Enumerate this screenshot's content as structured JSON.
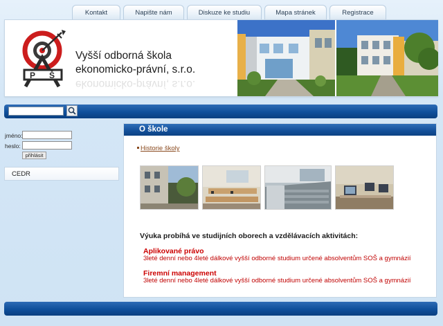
{
  "nav": {
    "tabs": [
      "Kontakt",
      "Napište nám",
      "Diskuze ke studiu",
      "Mapa stránek",
      "Registrace"
    ]
  },
  "header": {
    "logo_letters": [
      "P",
      "Š"
    ],
    "school_name_line1": "Vyšší odborná škola",
    "school_name_line2": "ekonomicko-právní, s.r.o."
  },
  "search": {
    "value": "",
    "icon": "magnifier-icon"
  },
  "login": {
    "name_label": "jméno:",
    "password_label": "heslo:",
    "submit_label": "přihlásit"
  },
  "sidebar": {
    "cedr_label": "CEDR"
  },
  "main": {
    "title": "O škole",
    "history_link": "Historie školy",
    "intro": "Výuka probíhá ve studijních oborech a vzdělávacích aktivitách:",
    "programs": [
      {
        "title": "Aplikované právo",
        "desc": "3leté denní nebo 4leté dálkové vyšší odborné studium určené absolventům SOŠ a gymnázií"
      },
      {
        "title": "Firemní management",
        "desc": "3leté denní nebo 4leté dálkové vyšší odborné studium určené absolventům SOŠ a gymnázií"
      }
    ]
  },
  "colors": {
    "blue_bar": "#124f98",
    "program_title": "#cc0000",
    "link": "#8a4a1f"
  }
}
